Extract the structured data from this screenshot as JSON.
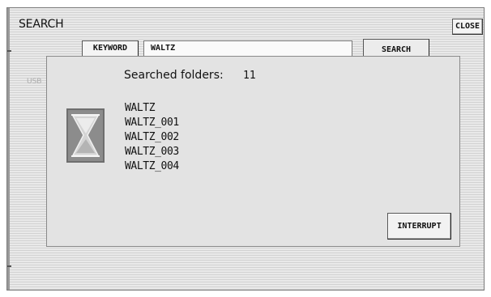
{
  "screen": {
    "title": "SEARCH",
    "close_label": "CLOSE"
  },
  "search_bar": {
    "keyword_label": "KEYWORD",
    "keyword_value": "WALTZ",
    "search_label": "SEARCH"
  },
  "background": {
    "source_label": "USB"
  },
  "dialog": {
    "searched_label": "Searched folders:",
    "searched_count": "11",
    "folders": [
      "WALTZ",
      "WALTZ_001",
      "WALTZ_002",
      "WALTZ_003",
      "WALTZ_004"
    ],
    "interrupt_label": "INTERRUPT",
    "icon": "hourglass-icon"
  },
  "colors": {
    "icon_frame": "#6e6e6e",
    "icon_fill": "#cfcfcf",
    "background_stripe": "#d2d2d2"
  }
}
